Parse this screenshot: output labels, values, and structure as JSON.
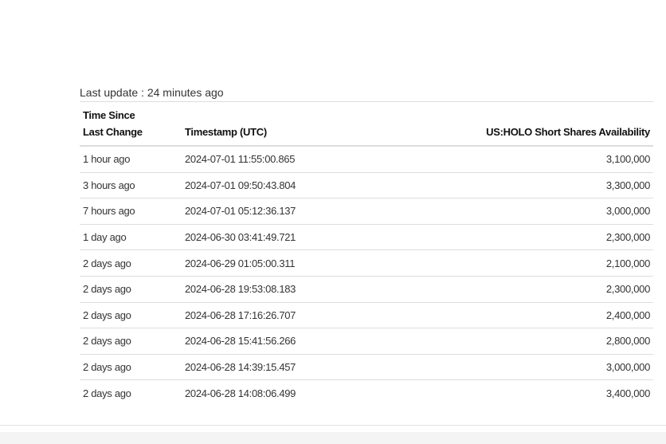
{
  "last_update": {
    "label": "Last update : 24 minutes ago"
  },
  "table": {
    "headers": {
      "since_line1": "Time Since",
      "since_line2": "Last Change",
      "timestamp": "Timestamp (UTC)",
      "availability": "US:HOLO Short Shares Availability"
    },
    "rows": [
      {
        "since": "1 hour ago",
        "timestamp": "2024-07-01 11:55:00.865",
        "shares": "3,100,000"
      },
      {
        "since": "3 hours ago",
        "timestamp": "2024-07-01 09:50:43.804",
        "shares": "3,300,000"
      },
      {
        "since": "7 hours ago",
        "timestamp": "2024-07-01 05:12:36.137",
        "shares": "3,000,000"
      },
      {
        "since": "1 day ago",
        "timestamp": "2024-06-30 03:41:49.721",
        "shares": "2,300,000"
      },
      {
        "since": "2 days ago",
        "timestamp": "2024-06-29 01:05:00.311",
        "shares": "2,100,000"
      },
      {
        "since": "2 days ago",
        "timestamp": "2024-06-28 19:53:08.183",
        "shares": "2,300,000"
      },
      {
        "since": "2 days ago",
        "timestamp": "2024-06-28 17:16:26.707",
        "shares": "2,400,000"
      },
      {
        "since": "2 days ago",
        "timestamp": "2024-06-28 15:41:56.266",
        "shares": "2,800,000"
      },
      {
        "since": "2 days ago",
        "timestamp": "2024-06-28 14:39:15.457",
        "shares": "3,000,000"
      },
      {
        "since": "2 days ago",
        "timestamp": "2024-06-28 14:08:06.499",
        "shares": "3,400,000"
      }
    ]
  }
}
